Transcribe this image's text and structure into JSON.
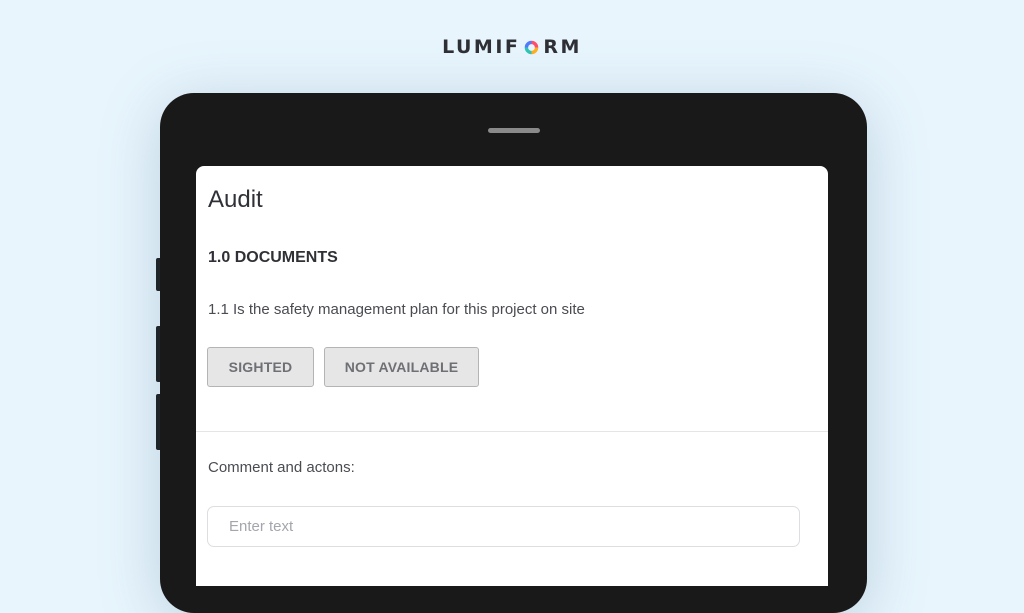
{
  "brand": {
    "name_left": "LUMIF",
    "name_right": "RM",
    "mark_icon": "colorful-o-logo-mark"
  },
  "form": {
    "title": "Audit",
    "section_title": "1.0 DOCUMENTS",
    "question": "1.1 Is the safety management plan for this project on site",
    "answers": {
      "sighted_label": "SIGHTED",
      "not_available_label": "NOT AVAILABLE"
    },
    "comment_label": "Comment and actons:",
    "comment_input": {
      "value": "",
      "placeholder": "Enter text"
    }
  },
  "colors": {
    "background": "#e8f5fd",
    "tablet_bezel": "#191919",
    "text_dark": "#2f3136",
    "button_bg": "#e6e6e6",
    "button_text": "#6f7075"
  }
}
